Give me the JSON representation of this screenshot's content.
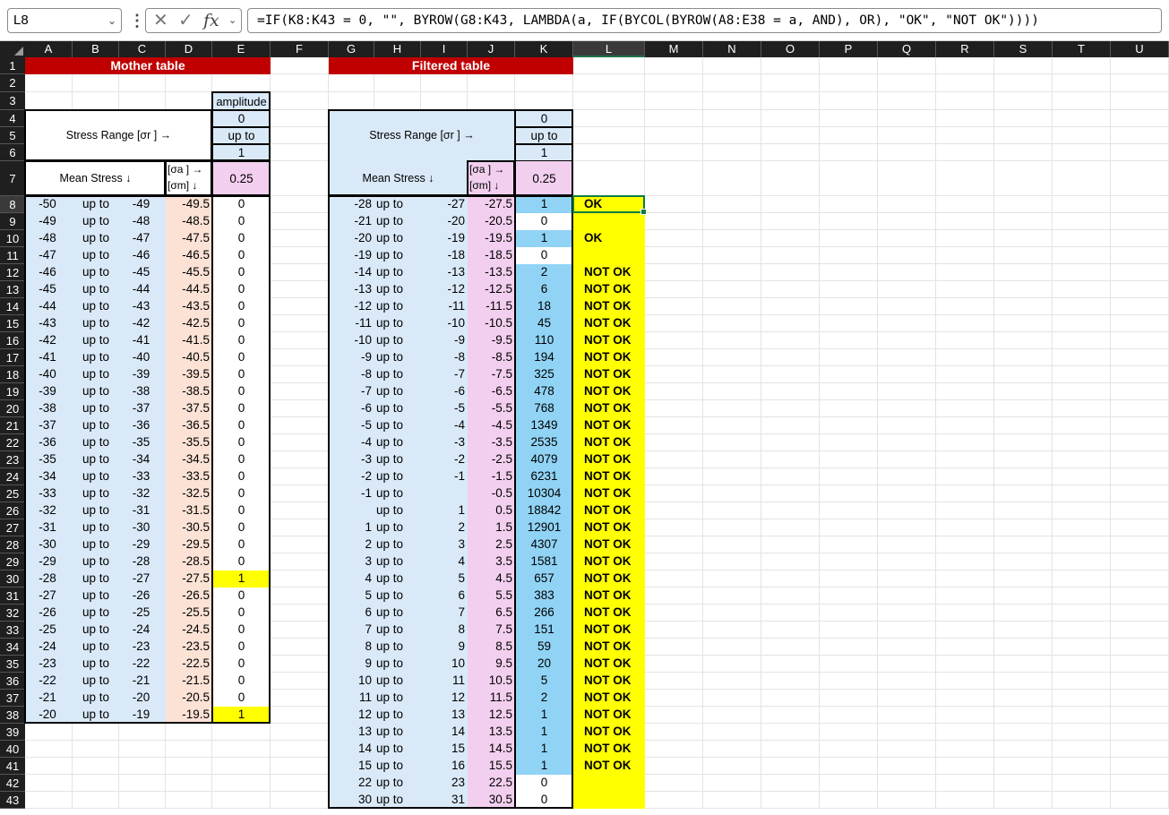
{
  "toolbar": {
    "name_box": "L8",
    "formula": "=IF(K8:K43 = 0, \"\", BYROW(G8:K43, LAMBDA(a, IF(BYCOL(BYROW(A8:E38 = a, AND), OR), \"OK\", \"NOT OK\"))))"
  },
  "columns": [
    "A",
    "B",
    "C",
    "D",
    "E",
    "F",
    "G",
    "H",
    "I",
    "J",
    "K",
    "L",
    "M",
    "N",
    "O",
    "P",
    "Q",
    "R",
    "S",
    "T",
    "U"
  ],
  "rows": [
    "1",
    "2",
    "3",
    "4",
    "5",
    "6",
    "7",
    "8",
    "9",
    "10",
    "11",
    "12",
    "13",
    "14",
    "15",
    "16",
    "17",
    "18",
    "19",
    "20",
    "21",
    "22",
    "23",
    "24",
    "25",
    "26",
    "27",
    "28",
    "29",
    "30",
    "31",
    "32",
    "33",
    "34",
    "35",
    "36",
    "37",
    "38",
    "39",
    "40",
    "41",
    "42",
    "43"
  ],
  "mother": {
    "title": "Mother table",
    "amplitude_label": "amplitude",
    "range_from": "0",
    "range_upto": "up to",
    "range_to": "1",
    "stress_range_label": "Stress Range [σr ] →",
    "mean_stress_label": "Mean Stress ↓",
    "sa_label": "[σa ] →",
    "sm_label": "[σm]  ↓",
    "amp_value": "0.25",
    "rows": [
      [
        "-50",
        "up to",
        "-49",
        "-49.5",
        "0"
      ],
      [
        "-49",
        "up to",
        "-48",
        "-48.5",
        "0"
      ],
      [
        "-48",
        "up to",
        "-47",
        "-47.5",
        "0"
      ],
      [
        "-47",
        "up to",
        "-46",
        "-46.5",
        "0"
      ],
      [
        "-46",
        "up to",
        "-45",
        "-45.5",
        "0"
      ],
      [
        "-45",
        "up to",
        "-44",
        "-44.5",
        "0"
      ],
      [
        "-44",
        "up to",
        "-43",
        "-43.5",
        "0"
      ],
      [
        "-43",
        "up to",
        "-42",
        "-42.5",
        "0"
      ],
      [
        "-42",
        "up to",
        "-41",
        "-41.5",
        "0"
      ],
      [
        "-41",
        "up to",
        "-40",
        "-40.5",
        "0"
      ],
      [
        "-40",
        "up to",
        "-39",
        "-39.5",
        "0"
      ],
      [
        "-39",
        "up to",
        "-38",
        "-38.5",
        "0"
      ],
      [
        "-38",
        "up to",
        "-37",
        "-37.5",
        "0"
      ],
      [
        "-37",
        "up to",
        "-36",
        "-36.5",
        "0"
      ],
      [
        "-36",
        "up to",
        "-35",
        "-35.5",
        "0"
      ],
      [
        "-35",
        "up to",
        "-34",
        "-34.5",
        "0"
      ],
      [
        "-34",
        "up to",
        "-33",
        "-33.5",
        "0"
      ],
      [
        "-33",
        "up to",
        "-32",
        "-32.5",
        "0"
      ],
      [
        "-32",
        "up to",
        "-31",
        "-31.5",
        "0"
      ],
      [
        "-31",
        "up to",
        "-30",
        "-30.5",
        "0"
      ],
      [
        "-30",
        "up to",
        "-29",
        "-29.5",
        "0"
      ],
      [
        "-29",
        "up to",
        "-28",
        "-28.5",
        "0"
      ],
      [
        "-28",
        "up to",
        "-27",
        "-27.5",
        "1"
      ],
      [
        "-27",
        "up to",
        "-26",
        "-26.5",
        "0"
      ],
      [
        "-26",
        "up to",
        "-25",
        "-25.5",
        "0"
      ],
      [
        "-25",
        "up to",
        "-24",
        "-24.5",
        "0"
      ],
      [
        "-24",
        "up to",
        "-23",
        "-23.5",
        "0"
      ],
      [
        "-23",
        "up to",
        "-22",
        "-22.5",
        "0"
      ],
      [
        "-22",
        "up to",
        "-21",
        "-21.5",
        "0"
      ],
      [
        "-21",
        "up to",
        "-20",
        "-20.5",
        "0"
      ],
      [
        "-20",
        "up to",
        "-19",
        "-19.5",
        "1"
      ]
    ]
  },
  "filtered": {
    "title": "Filtered table",
    "range_from": "0",
    "range_upto": "up to",
    "range_to": "1",
    "stress_range_label": "Stress Range [σr ] →",
    "mean_stress_label": "Mean Stress ↓",
    "sa_label": "[σa ] →",
    "sm_label": "[σm]  ↓",
    "amp_value": "0.25",
    "rows": [
      [
        "-28",
        "up to",
        "-27",
        "-27.5",
        "1",
        "OK"
      ],
      [
        "-21",
        "up to",
        "-20",
        "-20.5",
        "0",
        ""
      ],
      [
        "-20",
        "up to",
        "-19",
        "-19.5",
        "1",
        "OK"
      ],
      [
        "-19",
        "up to",
        "-18",
        "-18.5",
        "0",
        ""
      ],
      [
        "-14",
        "up to",
        "-13",
        "-13.5",
        "2",
        "NOT OK"
      ],
      [
        "-13",
        "up to",
        "-12",
        "-12.5",
        "6",
        "NOT OK"
      ],
      [
        "-12",
        "up to",
        "-11",
        "-11.5",
        "18",
        "NOT OK"
      ],
      [
        "-11",
        "up to",
        "-10",
        "-10.5",
        "45",
        "NOT OK"
      ],
      [
        "-10",
        "up to",
        "-9",
        "-9.5",
        "110",
        "NOT OK"
      ],
      [
        "-9",
        "up to",
        "-8",
        "-8.5",
        "194",
        "NOT OK"
      ],
      [
        "-8",
        "up to",
        "-7",
        "-7.5",
        "325",
        "NOT OK"
      ],
      [
        "-7",
        "up to",
        "-6",
        "-6.5",
        "478",
        "NOT OK"
      ],
      [
        "-6",
        "up to",
        "-5",
        "-5.5",
        "768",
        "NOT OK"
      ],
      [
        "-5",
        "up to",
        "-4",
        "-4.5",
        "1349",
        "NOT OK"
      ],
      [
        "-4",
        "up to",
        "-3",
        "-3.5",
        "2535",
        "NOT OK"
      ],
      [
        "-3",
        "up to",
        "-2",
        "-2.5",
        "4079",
        "NOT OK"
      ],
      [
        "-2",
        "up to",
        "-1",
        "-1.5",
        "6231",
        "NOT OK"
      ],
      [
        "-1",
        "up to",
        "",
        "-0.5",
        "10304",
        "NOT OK"
      ],
      [
        "",
        "up to",
        "1",
        "0.5",
        "18842",
        "NOT OK"
      ],
      [
        "1",
        "up to",
        "2",
        "1.5",
        "12901",
        "NOT OK"
      ],
      [
        "2",
        "up to",
        "3",
        "2.5",
        "4307",
        "NOT OK"
      ],
      [
        "3",
        "up to",
        "4",
        "3.5",
        "1581",
        "NOT OK"
      ],
      [
        "4",
        "up to",
        "5",
        "4.5",
        "657",
        "NOT OK"
      ],
      [
        "5",
        "up to",
        "6",
        "5.5",
        "383",
        "NOT OK"
      ],
      [
        "6",
        "up to",
        "7",
        "6.5",
        "266",
        "NOT OK"
      ],
      [
        "7",
        "up to",
        "8",
        "7.5",
        "151",
        "NOT OK"
      ],
      [
        "8",
        "up to",
        "9",
        "8.5",
        "59",
        "NOT OK"
      ],
      [
        "9",
        "up to",
        "10",
        "9.5",
        "20",
        "NOT OK"
      ],
      [
        "10",
        "up to",
        "11",
        "10.5",
        "5",
        "NOT OK"
      ],
      [
        "11",
        "up to",
        "12",
        "11.5",
        "2",
        "NOT OK"
      ],
      [
        "12",
        "up to",
        "13",
        "12.5",
        "1",
        "NOT OK"
      ],
      [
        "13",
        "up to",
        "14",
        "13.5",
        "1",
        "NOT OK"
      ],
      [
        "14",
        "up to",
        "15",
        "14.5",
        "1",
        "NOT OK"
      ],
      [
        "15",
        "up to",
        "16",
        "15.5",
        "1",
        "NOT OK"
      ],
      [
        "22",
        "up to",
        "23",
        "22.5",
        "0",
        ""
      ],
      [
        "30",
        "up to",
        "31",
        "30.5",
        "0",
        ""
      ]
    ]
  }
}
